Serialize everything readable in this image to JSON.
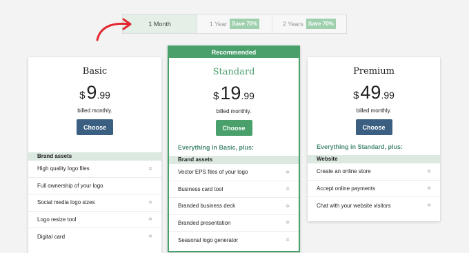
{
  "toggle": [
    {
      "label": "1 Month",
      "badge": ""
    },
    {
      "label": "1 Year",
      "badge": "Save 70%"
    },
    {
      "label": "2 Years",
      "badge": "Save 70%"
    }
  ],
  "plans": {
    "basic": {
      "name": "Basic",
      "currency": "$",
      "price": "9",
      "cents": ".99",
      "billing": "billed monthly.",
      "cta": "Choose",
      "section": "Brand assets",
      "features": [
        "High quality logo files",
        "Full ownership of your logo",
        "Social media logo sizes",
        "Logo resize tool",
        "Digital card"
      ]
    },
    "standard": {
      "ribbon": "Recommended",
      "name": "Standard",
      "currency": "$",
      "price": "19",
      "cents": ".99",
      "billing": "billed monthly.",
      "cta": "Choose",
      "everything": "Everything in Basic, plus:",
      "section": "Brand assets",
      "features": [
        "Vector EPS files of your logo",
        "Business card tool",
        "Branded business deck",
        "Branded presentation",
        "Seasonal logo generator"
      ]
    },
    "premium": {
      "name": "Premium",
      "currency": "$",
      "price": "49",
      "cents": ".99",
      "billing": "billed monthly.",
      "cta": "Choose",
      "everything": "Everything in Standard, plus:",
      "section": "Website",
      "features": [
        "Create an online store",
        "Accept online payments",
        "Chat with your website visitors"
      ]
    }
  },
  "colors": {
    "accent_green": "#4aa06b",
    "button_blue": "#3b5f81",
    "annotation_red": "#e3262f"
  }
}
